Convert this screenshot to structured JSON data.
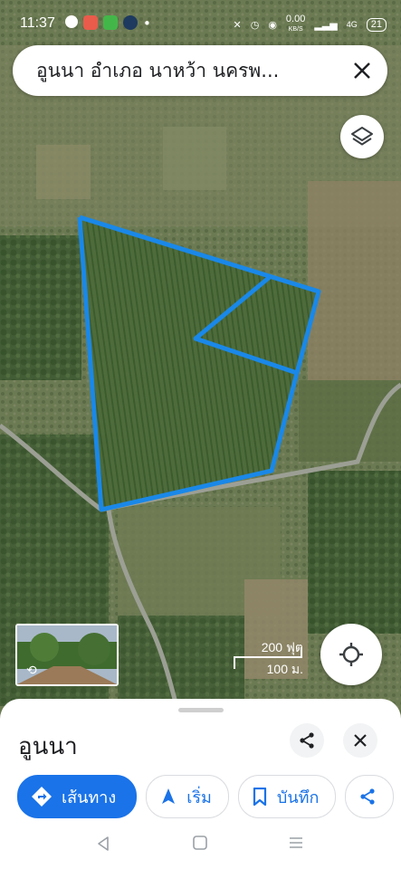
{
  "status_bar": {
    "time": "11:37",
    "network_speed": "0.00",
    "network_speed_unit": "KB/S",
    "network_type": "4G",
    "battery": "21"
  },
  "search": {
    "query": "อูนนา อำเภอ นาหว้า นครพ..."
  },
  "map": {
    "scale_top": "200 ฟุต",
    "scale_bottom": "100 ม.",
    "boundary_color": "#1a88e8"
  },
  "place": {
    "name": "อูนนา"
  },
  "actions": {
    "directions_label": "เส้นทาง",
    "start_label": "เริ่ม",
    "save_label": "บันทึก"
  },
  "colors": {
    "accent": "#1a73e8"
  }
}
